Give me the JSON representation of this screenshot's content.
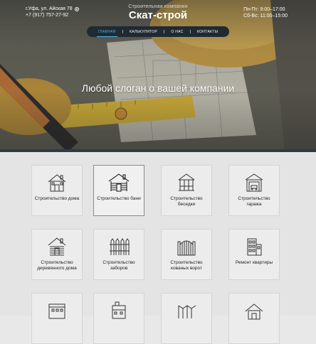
{
  "header": {
    "address": "г.Уфа, ул. Айская 78",
    "phone": "+7 (917) 757-27-92",
    "brand_sub": "Строительная компания",
    "brand_name": "Скат-строй",
    "hours_weekday": "Пн-Пт: 9:00–17:00",
    "hours_weekend": "Сб-Вс: 11:00–15:00"
  },
  "nav": {
    "items": [
      {
        "label": "ГЛАВНАЯ",
        "active": true
      },
      {
        "label": "КАЛЬКУЛЯТОР"
      },
      {
        "label": "О НАС"
      },
      {
        "label": "КОНТАКТЫ"
      }
    ]
  },
  "hero": {
    "slogan": "Любой слоган о вашей компании"
  },
  "services": [
    {
      "label": "Строительство дома",
      "icon": "house-icon"
    },
    {
      "label": "Строительство бани",
      "icon": "bathhouse-icon",
      "active": true
    },
    {
      "label": "Строительство беседки",
      "icon": "gazebo-icon"
    },
    {
      "label": "Строительство гаража",
      "icon": "garage-icon"
    },
    {
      "label": "Строительство деревянного дома",
      "icon": "log-house-icon"
    },
    {
      "label": "Строительство заборов",
      "icon": "fence-icon"
    },
    {
      "label": "Строительство кованых ворот",
      "icon": "gate-icon"
    },
    {
      "label": "Ремонт квартиры",
      "icon": "apartment-icon"
    },
    {
      "label": "",
      "icon": "building-icon"
    },
    {
      "label": "",
      "icon": "factory-icon"
    },
    {
      "label": "",
      "icon": "panels-icon"
    },
    {
      "label": "",
      "icon": "house-outline-icon"
    }
  ],
  "colors": {
    "nav_bg": "#1f2a33",
    "nav_active": "#4fb3e8",
    "tile_bg": "#ececec"
  }
}
